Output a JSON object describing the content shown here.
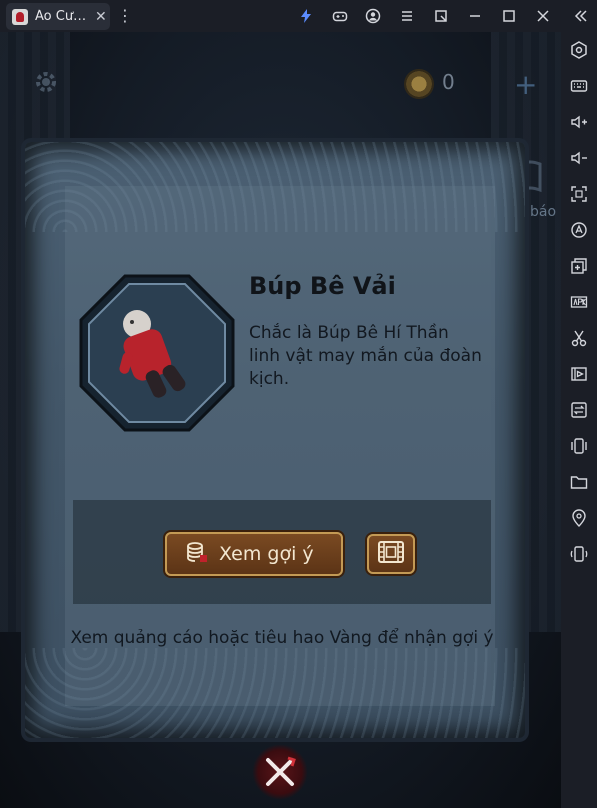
{
  "window": {
    "tab_title": "Áo Cư…",
    "tab_close": "✕",
    "menu_glyph": "⋮"
  },
  "colors": {
    "accent": "#4a8cff",
    "button_gold": "#c39a55",
    "button_brown": "#6a3e1c",
    "close_red": "#d2323a"
  },
  "topbar": {
    "coin_count": "0",
    "add_label": "+",
    "side_label": "báo"
  },
  "item": {
    "title": "Búp Bê Vải",
    "description": "Chắc là Búp Bê Hí Thần linh vật may mắn của đoàn kịch."
  },
  "hint": {
    "button_label": "Xem gợi ý",
    "footer": "Xem quảng cáo hoặc tiêu hao Vàng để nhận gợi ý"
  },
  "icons": {
    "titlebar": [
      "bolt-icon",
      "gamepad-icon",
      "account-icon",
      "hamburger-icon",
      "window-mode-icon",
      "minimize-icon",
      "maximize-icon",
      "close-icon"
    ],
    "sidebar": [
      "settings-hex-icon",
      "keyboard-icon",
      "volume-up-icon",
      "volume-down-icon",
      "fullscreen-icon",
      "auto-macro-icon",
      "multi-instance-icon",
      "apk-install-icon",
      "screenshot-scissors-icon",
      "record-video-icon",
      "sync-icon",
      "shake-icon",
      "folder-icon",
      "location-icon",
      "rotate-icon"
    ]
  }
}
